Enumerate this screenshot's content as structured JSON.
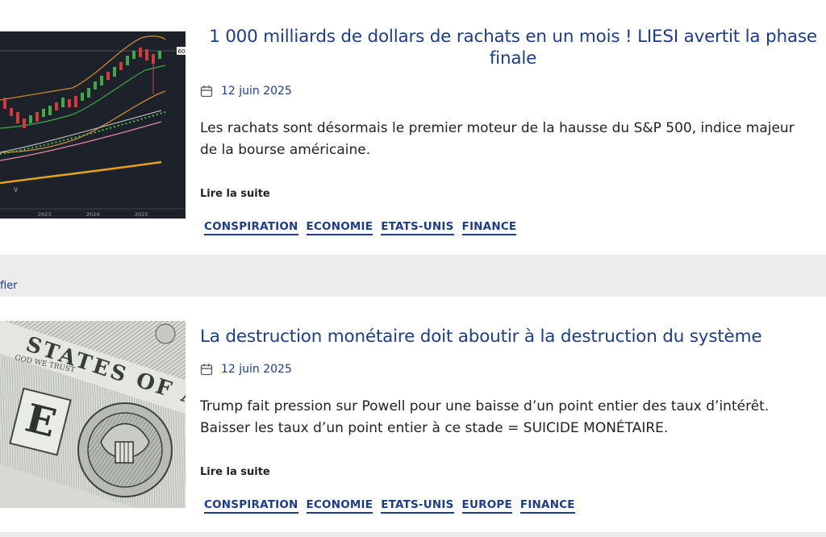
{
  "side_link": "fier",
  "articles": [
    {
      "title": "1 000 milliards de dollars de rachats en un mois ! LIESI avertit la phase finale",
      "date": "12 juin 2025",
      "excerpt": "Les rachats sont désormais le premier moteur de la hausse du S&P 500, indice majeur de la bourse américaine.",
      "read_more": "Lire la suite",
      "thumb_labels": {
        "y1": "2023",
        "y2": "2024",
        "y3": "2025",
        "price": "60"
      },
      "tags": [
        "CONSPIRATION",
        "ECONOMIE",
        "ETATS-UNIS",
        "FINANCE"
      ]
    },
    {
      "title": "La destruction monétaire doit aboutir à la destruction du système",
      "date": "12 juin 2025",
      "excerpt": "Trump fait pression sur Powell pour une baisse d’un point entier des taux d’intérêt. Baisser les taux d’un point entier à ce stade = SUICIDE MONÉTAIRE.",
      "read_more": "Lire la suite",
      "tags": [
        "CONSPIRATION",
        "ECONOMIE",
        "ETATS-UNIS",
        "EUROPE",
        "FINANCE"
      ]
    }
  ],
  "colors": {
    "accent": "#1d3d8c",
    "text": "#222222",
    "background": "#ebebeb",
    "card": "#ffffff"
  }
}
